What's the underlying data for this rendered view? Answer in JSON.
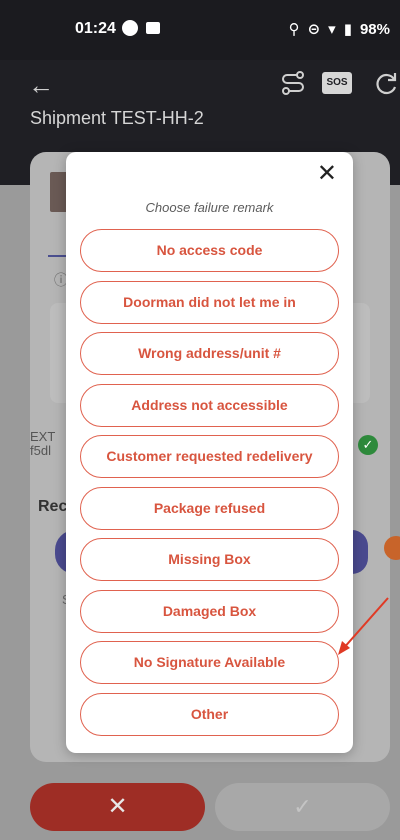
{
  "status_bar": {
    "time": "01:24",
    "battery": "98%"
  },
  "header": {
    "title": "Shipment TEST-HH-2",
    "sos_label": "SOS"
  },
  "background": {
    "ext_line1": "EXT",
    "ext_line2": "f5dl",
    "rec_label": "Rec",
    "s_label": "S"
  },
  "modal": {
    "title": "Choose failure remark",
    "options": [
      "No access code",
      "Doorman did not let me in",
      "Wrong address/unit #",
      "Address not accessible",
      "Customer requested redelivery",
      "Package refused",
      "Missing Box",
      "Damaged Box",
      "No Signature Available",
      "Other"
    ]
  },
  "bottom": {
    "fail_label": "✕",
    "ok_label": "✓"
  },
  "colors": {
    "accent": "#d8553f",
    "annotation": "#e03a25"
  }
}
